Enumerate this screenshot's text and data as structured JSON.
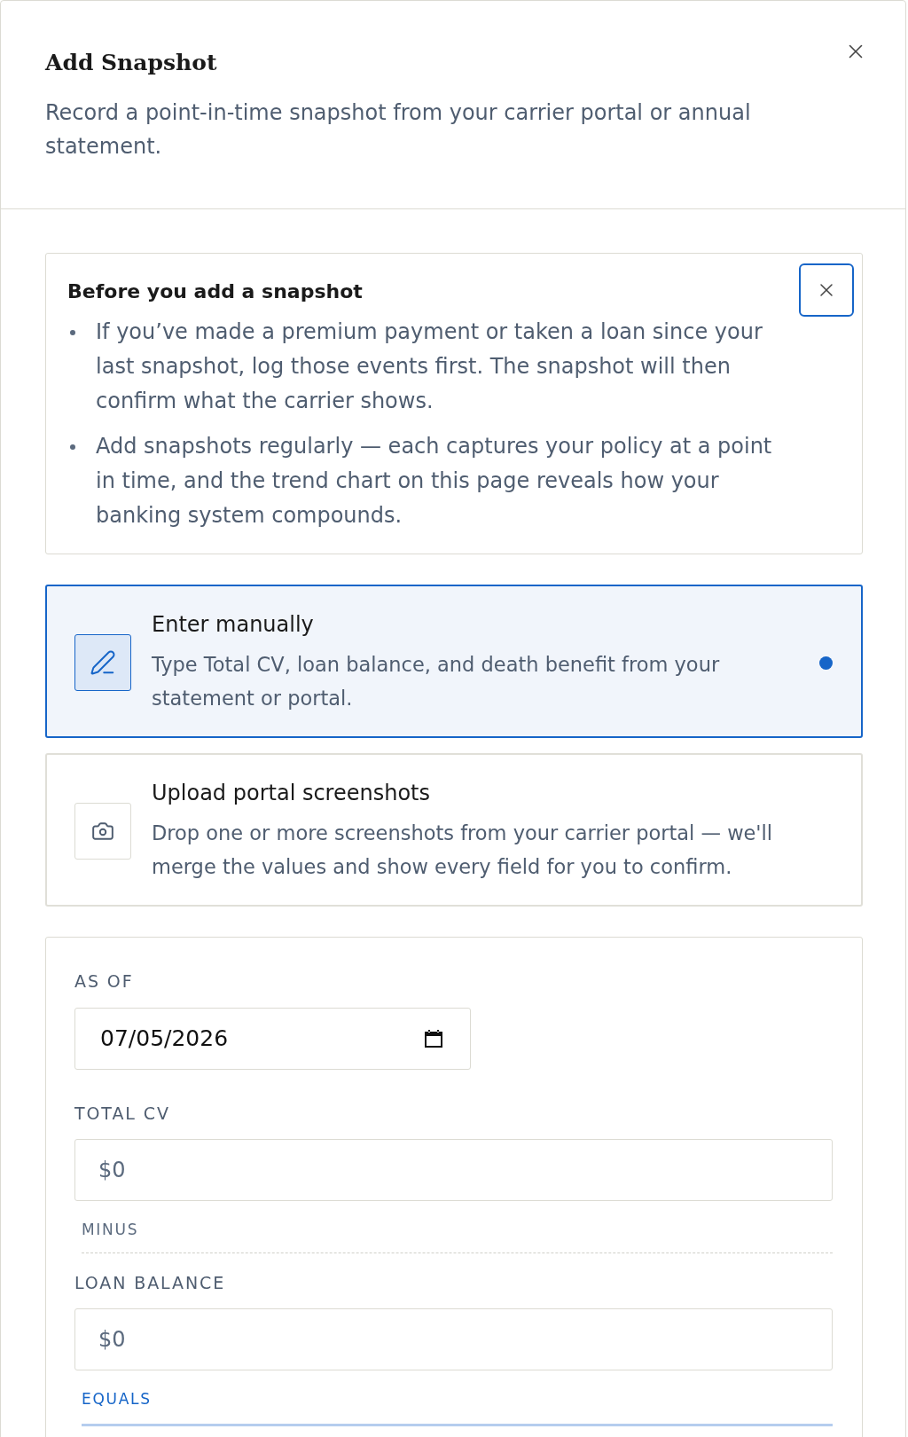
{
  "dialog": {
    "title": "Add Snapshot",
    "subtitle": "Record a point-in-time snapshot from your carrier portal or annual statement."
  },
  "notice": {
    "title": "Before you add a snapshot",
    "close_focused": true,
    "items": [
      "If you’ve made a premium payment or taken a loan since your last snapshot, log those events first. The snapshot will then confirm what the carrier shows.",
      "Add snapshots regularly — each captures your policy at a point in time, and the trend chart on this page reveals how your banking system compounds."
    ]
  },
  "entry_methods": [
    {
      "kind": "manual",
      "title": "Enter manually",
      "description": "Type Total CV, loan balance, and death benefit from your statement or portal.",
      "selected": true
    },
    {
      "kind": "upload",
      "title": "Upload portal screenshots",
      "description": "Drop one or more screenshots from your carrier portal — we'll merge the values and show every field for you to confirm.",
      "selected": false
    }
  ],
  "form": {
    "fields": [
      {
        "kind": "date",
        "label": "AS OF",
        "value": "07/05/2026"
      },
      {
        "kind": "money",
        "label": "TOTAL CV",
        "placeholder": "$0"
      },
      {
        "kind": "operator",
        "label": "MINUS",
        "highlighted": false
      },
      {
        "kind": "money",
        "label": "LOAN BALANCE",
        "placeholder": "$0"
      },
      {
        "kind": "operator",
        "label": "EQUALS",
        "highlighted": true
      }
    ]
  }
}
